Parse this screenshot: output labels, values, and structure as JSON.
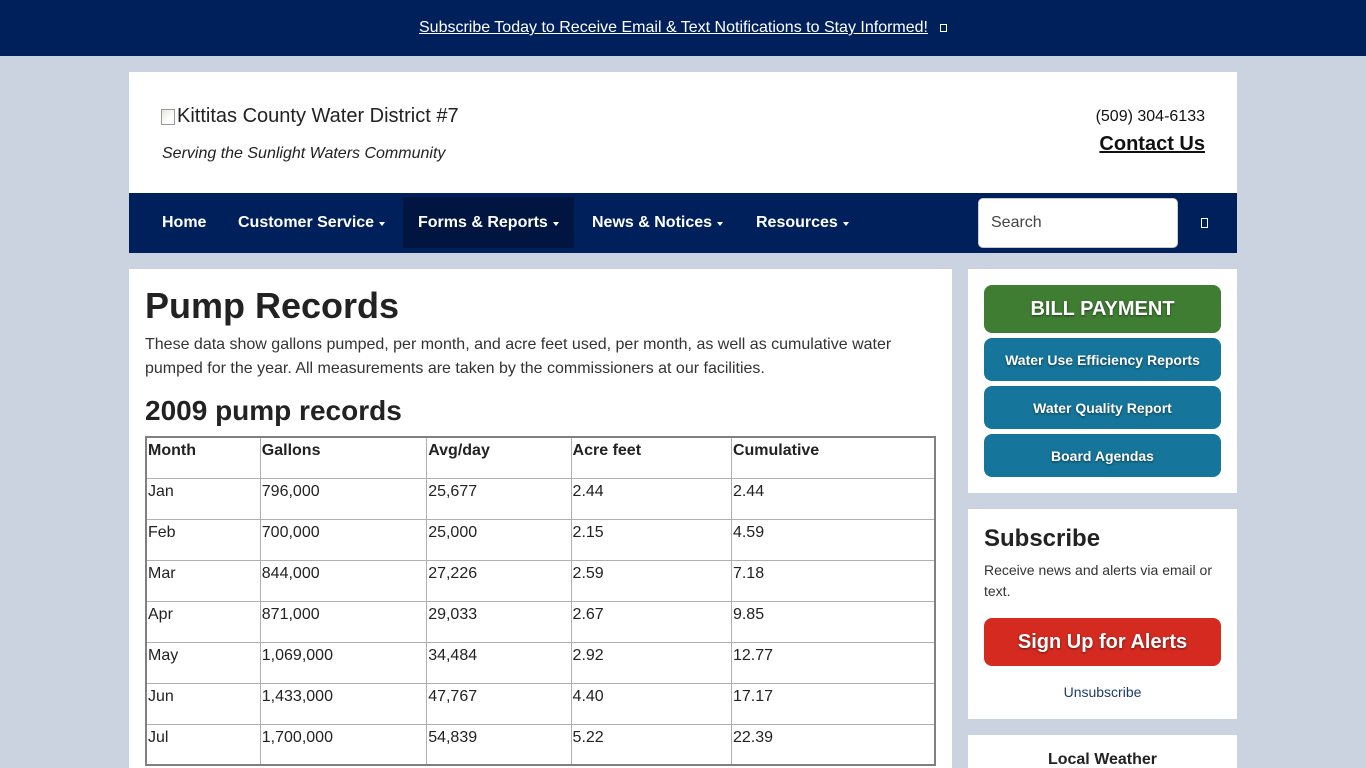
{
  "topbar": {
    "link": "Subscribe Today to Receive Email & Text Notifications to Stay Informed!"
  },
  "header": {
    "logo_alt": "Kittitas County Water District #7",
    "tagline": "Serving the Sunlight Waters Community",
    "phone": "(509) 304-6133",
    "contact": "Contact Us"
  },
  "nav": {
    "items": [
      {
        "label": "Home"
      },
      {
        "label": "Customer Service"
      },
      {
        "label": "Forms & Reports"
      },
      {
        "label": "News & Notices"
      },
      {
        "label": "Resources"
      }
    ],
    "search_placeholder": "Search"
  },
  "main": {
    "title": "Pump Records",
    "intro": "These data show gallons pumped, per month, and acre feet used, per month, as well as cumulative water pumped for the year. All measurements are taken by the commissioners at our facilities.",
    "subtitle": "2009 pump records",
    "table": {
      "headers": [
        "Month",
        "Gallons",
        "Avg/day",
        "Acre feet",
        "Cumulative"
      ],
      "rows": [
        [
          "Jan",
          "796,000",
          "25,677",
          "2.44",
          "2.44"
        ],
        [
          "Feb",
          "700,000",
          "25,000",
          "2.15",
          "4.59"
        ],
        [
          "Mar",
          "844,000",
          "27,226",
          "2.59",
          "7.18"
        ],
        [
          "Apr",
          "871,000",
          "29,033",
          "2.67",
          "9.85"
        ],
        [
          "May",
          "1,069,000",
          "34,484",
          "2.92",
          "12.77"
        ],
        [
          "Jun",
          "1,433,000",
          "47,767",
          "4.40",
          "17.17"
        ],
        [
          "Jul",
          "1,700,000",
          "54,839",
          "5.22",
          "22.39"
        ]
      ]
    }
  },
  "sidebar": {
    "bill_payment": "BILL PAYMENT",
    "links": [
      "Water Use Efficiency Reports",
      "Water Quality Report",
      "Board Agendas"
    ],
    "subscribe_title": "Subscribe",
    "subscribe_text": "Receive news and alerts via email or text.",
    "signup": "Sign Up for Alerts",
    "unsubscribe": "Unsubscribe",
    "weather_title": "Local Weather"
  },
  "colors": {
    "navy": "#00205b",
    "nav_active": "#001641",
    "bill_green": "#3f7d32",
    "teal": "#16759a",
    "alert_red": "#d42a20",
    "page_bg": "#cbd2e0"
  }
}
